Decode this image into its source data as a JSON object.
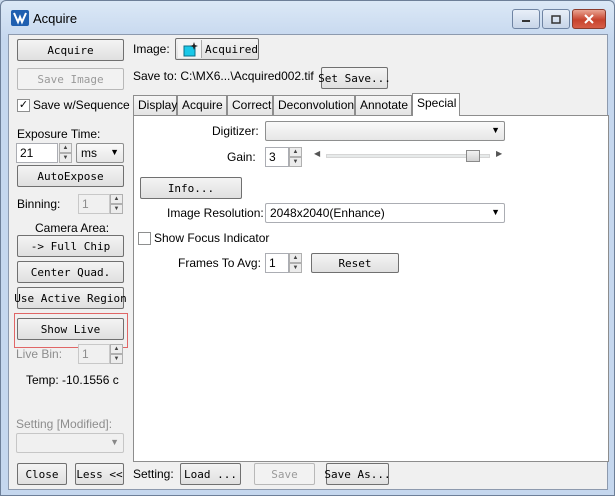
{
  "window": {
    "title": "Acquire",
    "icon": "app-logo-icon",
    "controls": [
      "minimize-icon",
      "maximize-icon",
      "close-icon"
    ]
  },
  "left": {
    "acquire_label": "Acquire",
    "save_image_label": "Save Image",
    "save_seq_label": "Save w/Sequence",
    "save_seq_checked": true,
    "exposure_label": "Exposure Time:",
    "exposure_value": "21",
    "exposure_unit": "ms",
    "autoexpose_label": "AutoExpose",
    "binning_label": "Binning:",
    "binning_value": "1",
    "camera_area_label": "Camera Area:",
    "full_chip_label": "-> Full Chip",
    "center_quad_label": "Center Quad.",
    "use_active_region_label": "Use Active Region",
    "show_live_label": "Show Live",
    "live_bin_label": "Live Bin:",
    "live_bin_value": "1",
    "temp_text": "Temp: -10.1556 c",
    "setting_label": "Setting [Modified]:",
    "setting_value": "",
    "close_label": "Close",
    "less_label": "Less <<"
  },
  "header": {
    "image_label": "Image:",
    "image_button_label": "Acquired",
    "save_to_text": "Save to: C:\\MX6...\\Acquired002.tif",
    "set_save_label": "Set Save..."
  },
  "tabs": [
    {
      "label": "Display",
      "active": false
    },
    {
      "label": "Acquire",
      "active": false
    },
    {
      "label": "Correct",
      "active": false
    },
    {
      "label": "Deconvolution",
      "active": false
    },
    {
      "label": "Annotate",
      "active": false
    },
    {
      "label": "Special",
      "active": true
    }
  ],
  "special": {
    "digitizer_label": "Digitizer:",
    "digitizer_value": "",
    "gain_label": "Gain:",
    "gain_value": "3",
    "gain_slider_fraction": 0.93,
    "info_label": "Info...",
    "image_resolution_label": "Image Resolution:",
    "image_resolution_value": "2048x2040(Enhance)",
    "show_focus_label": "Show Focus Indicator",
    "show_focus_checked": false,
    "frames_to_avg_label": "Frames To Avg:",
    "frames_to_avg_value": "1",
    "reset_label": "Reset"
  },
  "footer": {
    "setting_label": "Setting:",
    "load_label": "Load ...",
    "save_label": "Save",
    "save_as_label": "Save As..."
  }
}
